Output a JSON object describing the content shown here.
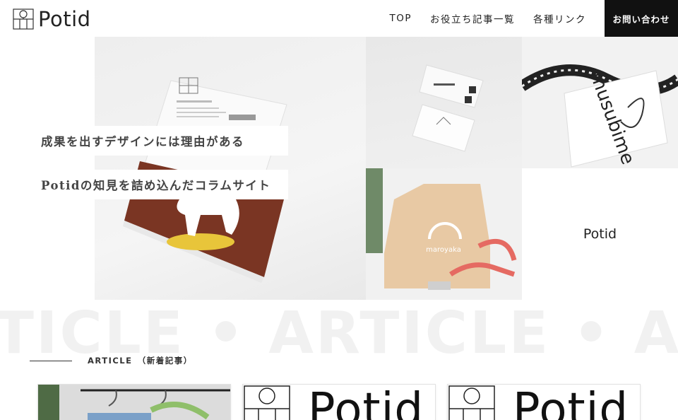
{
  "header": {
    "logo_text": "Potid",
    "nav": [
      {
        "label": "TOP"
      },
      {
        "label": "お役立ち記事一覧"
      },
      {
        "label": "各種リンク"
      }
    ],
    "contact_label": "お問い合わせ"
  },
  "hero": {
    "line1": "成果を出すデザインには理由がある",
    "line2": "Potidの知見を詰め込んだコラムサイト",
    "panel_brand": "Potid",
    "card_shop_label": "musubime",
    "box_label": "maroyaka"
  },
  "watermark": "TICLE • ARTICLE • ART",
  "section": {
    "label": "ARTICLE　（新着記事）"
  },
  "cards": [
    {
      "logo_text": ""
    },
    {
      "logo_text": "Potid"
    },
    {
      "logo_text": "Potid"
    }
  ],
  "colors": {
    "accent_dark": "#111111",
    "text": "#333333",
    "watermark": "#f1f1f1"
  }
}
